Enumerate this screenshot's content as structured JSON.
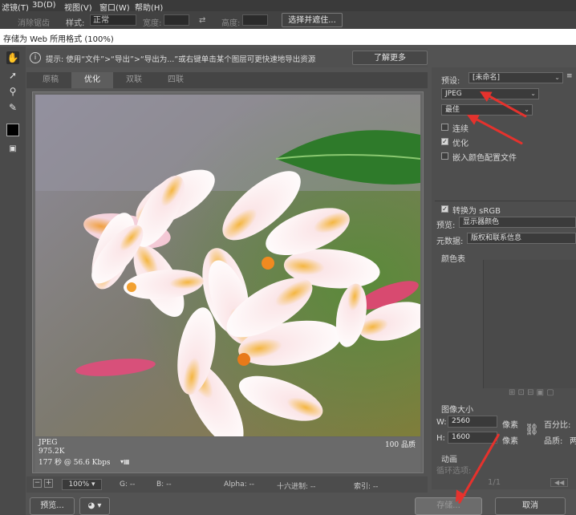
{
  "menubar": {
    "items": [
      "滤镜(T)",
      "3D(D)",
      "视图(V)",
      "窗口(W)",
      "帮助(H)"
    ]
  },
  "options": {
    "feather_label": "消除锯齿",
    "style_label": "样式:",
    "style_value": "正常",
    "width_label": "宽度:",
    "height_label": "高度:",
    "select_mask_button": "选择并遮住..."
  },
  "dialog": {
    "title": "存储为 Web 所用格式 (100%)"
  },
  "hint": {
    "text": "提示: 使用“文件”>“导出”>“导出为...”或右键单击某个图层可更快速地导出资源",
    "learn_more": "了解更多"
  },
  "tabs": [
    {
      "label": "原稿"
    },
    {
      "label": "优化"
    },
    {
      "label": "双联"
    },
    {
      "label": "四联"
    }
  ],
  "preview_info": {
    "format": "JPEG",
    "size": "975.2K",
    "time": "177 秒 @ 56.6 Kbps",
    "quality": "100 品质"
  },
  "status": {
    "zoom": "100%",
    "g": "G: --",
    "b": "B: --",
    "alpha": "Alpha: --",
    "hex": "十六进制: --",
    "index": "索引: --"
  },
  "settings": {
    "preset_label": "预设:",
    "preset_value": "[未命名]",
    "format_value": "JPEG",
    "quality_value": "最佳",
    "progressive_label": "连续",
    "optimized_label": "优化",
    "embed_profile_label": "嵌入颜色配置文件",
    "convert_srgb_label": "转换为 sRGB",
    "preview_label": "预览:",
    "preview_value": "显示器颜色",
    "metadata_label": "元数据:",
    "metadata_value": "版权和联系信息",
    "color_table_label": "颜色表",
    "image_size_label": "图像大小",
    "width_label": "W:",
    "width_value": "2560",
    "height_label": "H:",
    "height_value": "1600",
    "px1": "像素",
    "px2": "像素",
    "percent_label": "百分比:",
    "quality_label": "品质:",
    "quality_short": "两",
    "animation_label": "动画",
    "loop_label": "循环选项:",
    "frame_counter": "1/1"
  },
  "buttons": {
    "preview": "预览...",
    "save": "存储...",
    "cancel": "取消"
  },
  "colors": {
    "arrow": "#e5322d"
  }
}
